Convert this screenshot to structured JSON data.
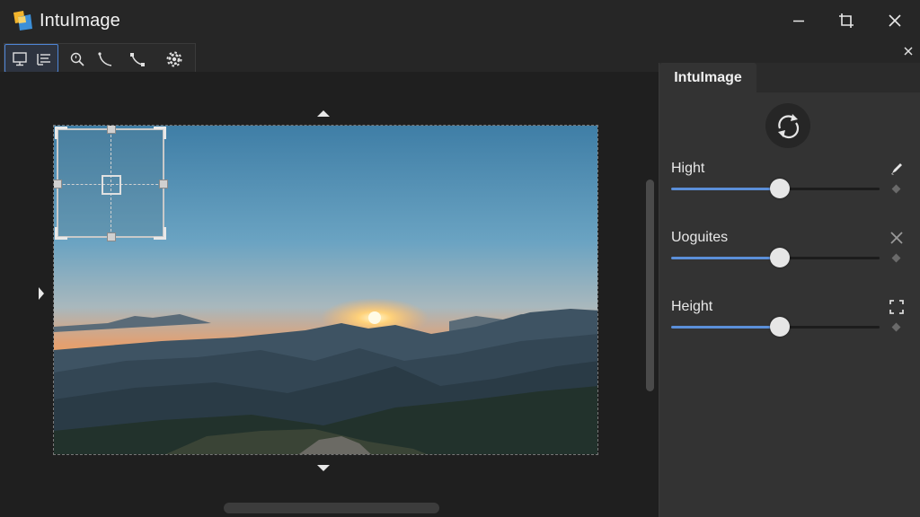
{
  "app": {
    "title": "IntuImage"
  },
  "window_controls": [
    "minimize-icon",
    "restore-icon",
    "close-icon"
  ],
  "toolbar": {
    "tools": [
      "display-icon",
      "list-icon",
      "zoom-icon",
      "curve-pen-icon",
      "path-node-icon",
      "settings-icon"
    ],
    "active_index": 0
  },
  "panel": {
    "tab_label": "IntuImage",
    "sliders": [
      {
        "label": "Hight",
        "icon": "pen-icon",
        "value": 0.52
      },
      {
        "label": "Uoguites",
        "icon": "close-icon",
        "value": 0.52
      },
      {
        "label": "Height",
        "icon": "expand-icon",
        "value": 0.52
      }
    ]
  },
  "colors": {
    "accent": "#5b8fd9",
    "background": "#1e1e1e",
    "panel": "#333333"
  }
}
